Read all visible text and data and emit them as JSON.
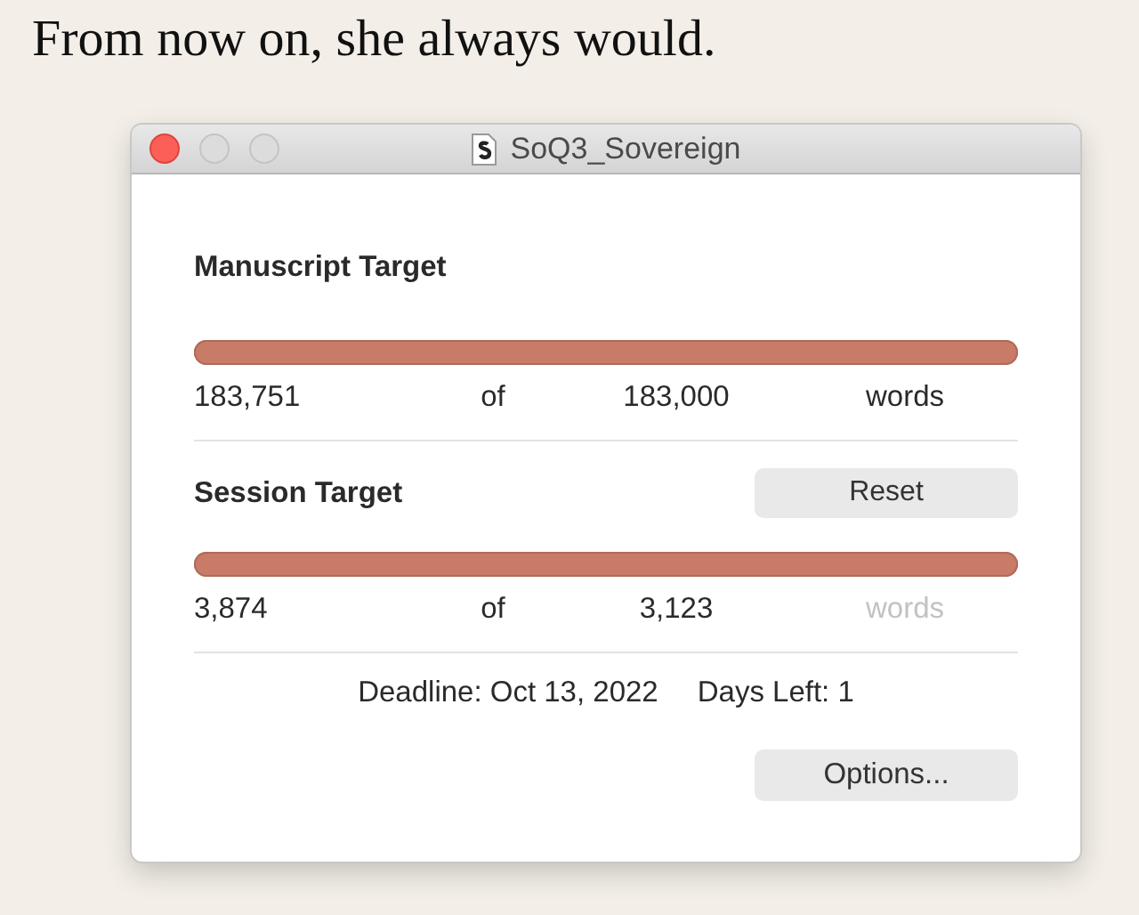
{
  "background_text": "From now on, she always would.",
  "window": {
    "title": "SoQ3_Sovereign"
  },
  "targets": [
    {
      "title": "Manuscript Target",
      "level": 1,
      "count": "183,751",
      "of": "of",
      "target": "183,000",
      "unit": "words",
      "unit_dimmed": false
    },
    {
      "title": "Session Target",
      "level": 1,
      "count": "3,874",
      "of": "of",
      "target": "3,123",
      "unit": "words",
      "unit_dimmed": true,
      "button": "Reset"
    }
  ],
  "deadline": "Deadline: Oct 13, 2022",
  "days_left": "Days Left: 1",
  "options_button": "Options..."
}
